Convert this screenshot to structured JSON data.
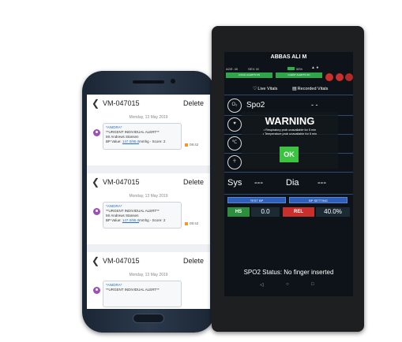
{
  "phone": {
    "messages": [
      {
        "header_id": "VM-047015",
        "delete_label": "Delete",
        "date": "Monday, 13 May 2019",
        "sender": "*ANIDRA*",
        "line1": "**URGENT INDIVIDUAL ALERT**",
        "line2": "Mr Andrews Stansen",
        "line3_prefix": "BP Value: ",
        "line3_link": "147.0/95.0",
        "line3_suffix": "mmhg - Score: 2",
        "time": "09:42"
      },
      {
        "header_id": "VM-047015",
        "delete_label": "Delete",
        "date": "Monday, 13 May 2019",
        "sender": "*ANIDRA*",
        "line1": "**URGENT INDIVIDUAL ALERT**",
        "line2": "Mr Andrews Stansen",
        "line3_prefix": "BP Value: ",
        "line3_link": "147.0/95.0",
        "line3_suffix": "mmhg - Score: 2",
        "time": "09:42"
      },
      {
        "header_id": "VM-047015",
        "delete_label": "Delete",
        "date": "Monday, 13 May 2019",
        "sender": "*ANIDRA*",
        "line1": "**URGENT INDIVIDUAL ALERT**",
        "line2": "",
        "line3_prefix": "",
        "line3_link": "",
        "line3_suffix": "",
        "time": ""
      }
    ]
  },
  "tablet": {
    "patient_name": "ABBAS ALI M",
    "age": "AGE: 40",
    "sex": "SEX: M",
    "battery": "55%",
    "alert_left": "LOCAL ALERTS ON",
    "alert_right": "GUEST ALERTS ON",
    "tabs": [
      {
        "label": "Live Vitals"
      },
      {
        "label": "Recorded Vitals"
      }
    ],
    "spo2_label": "Spo2",
    "spo2_value": "- -",
    "sys_label": "Sys",
    "sys_value": "---",
    "dia_label": "Dia",
    "dia_value": "---",
    "test_bp": "TEST BP",
    "bp_setting": "BP SETTING",
    "hs_label": "HS",
    "hs_value": "0.0",
    "rel_label": "REL",
    "rel_value": "40.0%",
    "status": "SPO2 Status: No finger inserted",
    "modal": {
      "title": "WARNING",
      "line1": "• Respiratory prob unavailable for 5 min",
      "line2": "• Temperature prob unavailable for 5 min",
      "ok": "OK"
    }
  }
}
